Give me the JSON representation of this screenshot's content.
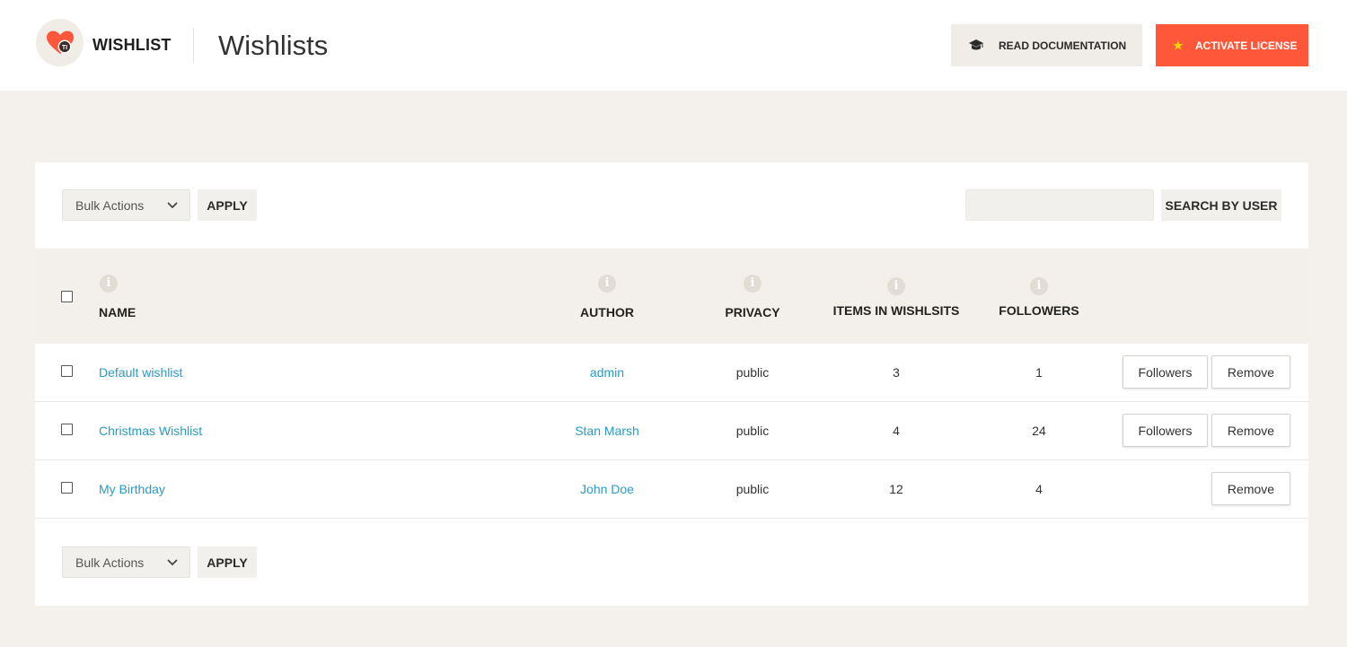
{
  "header": {
    "brand": "WISHLIST",
    "page_title": "Wishlists",
    "doc_button": "READ DOCUMENTATION",
    "license_button": "ACTIVATE LICENSE",
    "accent_color": "#ff5739"
  },
  "toolbar_top": {
    "bulk_select": "Bulk Actions",
    "apply": "APPLY",
    "search_placeholder": "",
    "search_button": "SEARCH BY USER"
  },
  "table": {
    "columns": {
      "name": "NAME",
      "author": "AUTHOR",
      "privacy": "PRIVACY",
      "items": "ITEMS IN WISHLSITS",
      "followers": "FOLLOWERS"
    },
    "info_glyph": "i",
    "rows": [
      {
        "name": "Default wishlist",
        "author": "admin",
        "privacy": "public",
        "items": "3",
        "followers": "1",
        "followers_btn": "Followers",
        "remove_btn": "Remove"
      },
      {
        "name": "Christmas Wishlist",
        "author": "Stan Marsh",
        "privacy": "public",
        "items": "4",
        "followers": "24",
        "followers_btn": "Followers",
        "remove_btn": "Remove"
      },
      {
        "name": "My Birthday",
        "author": "John Doe",
        "privacy": "public",
        "items": "12",
        "followers": "4",
        "remove_btn": "Remove"
      }
    ]
  },
  "toolbar_bottom": {
    "bulk_select": "Bulk Actions",
    "apply": "APPLY"
  },
  "icons": {
    "logo": "heart-logo-icon",
    "doc": "graduation-cap-icon",
    "license": "star-icon",
    "chevron": "chevron-down-icon",
    "info": "info-icon"
  }
}
